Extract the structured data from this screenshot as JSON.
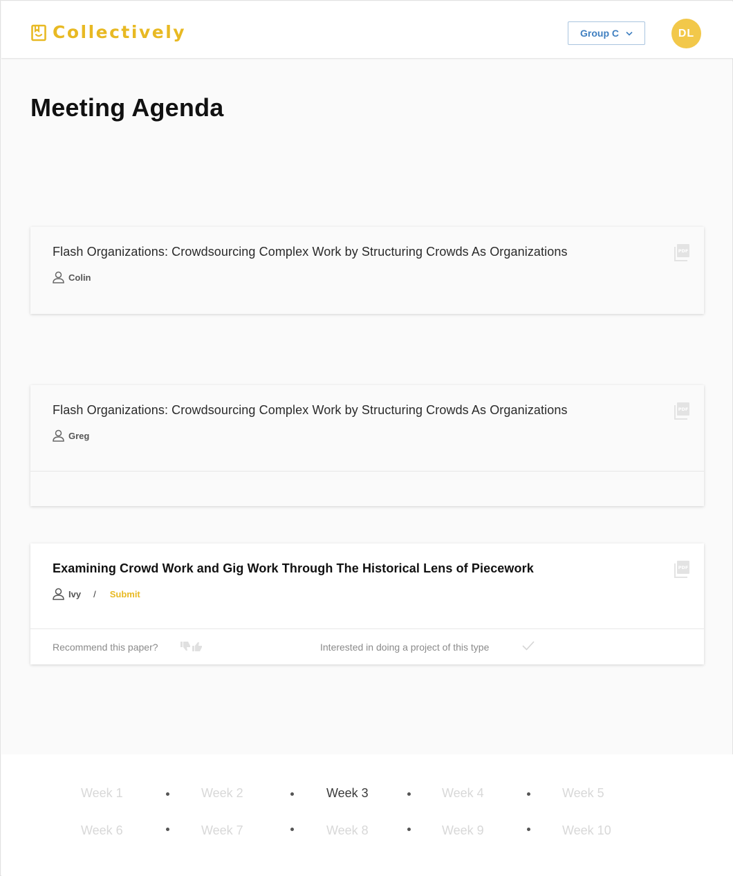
{
  "app": {
    "name": "Collectively"
  },
  "header": {
    "group_label": "Group C",
    "avatar_initials": "DL"
  },
  "page": {
    "title": "Meeting Agenda"
  },
  "agenda": [
    {
      "title": "Flash Organizations: Crowdsourcing Complex Work by Structuring Crowds As Organizations",
      "presenter": "Colin"
    },
    {
      "title": "Flash Organizations: Crowdsourcing Complex Work by Structuring Crowds As Organizations",
      "presenter": "Greg"
    },
    {
      "title": "Examining Crowd Work and Gig Work Through The Historical Lens of Piecework",
      "presenter": "Ivy",
      "separator": "/",
      "submit_label": "Submit",
      "recommend_label": "Recommend this paper?",
      "interest_label": "Interested in doing a project of this type"
    }
  ],
  "weeks": {
    "row1": [
      "Week 1",
      "Week 2",
      "Week 3",
      "Week 4",
      "Week 5"
    ],
    "row2": [
      "Week 6",
      "Week 7",
      "Week 8",
      "Week 9",
      "Week 10"
    ],
    "current": "Week 3"
  },
  "colors": {
    "brand": "#e8b923",
    "avatar": "#f2c84a",
    "select_text": "#3f7fc0",
    "inactive_week": "#d8d8d8"
  },
  "icons": [
    "logo-book-icon",
    "chevron-down-icon",
    "pdf-icon",
    "person-icon",
    "thumbs-down-icon",
    "thumbs-up-icon",
    "checkmark-icon"
  ]
}
